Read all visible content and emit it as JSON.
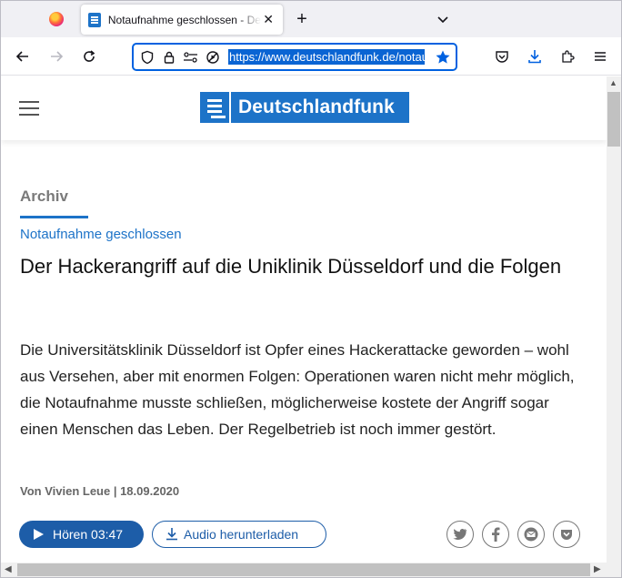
{
  "browser": {
    "tab_title": "Notaufnahme geschlossen - Deutschlandfunk",
    "tab_close": "✕",
    "new_tab": "+",
    "url": "https://www.deutschlandfunk.de/notaufnahme"
  },
  "site": {
    "logo_text": "Deutschlandfunk"
  },
  "article": {
    "section": "Archiv",
    "kicker": "Notaufnahme geschlossen",
    "headline": "Der Hackerangriff auf die Uniklinik Düsseldorf und die Folgen",
    "teaser": "Die Universitätsklinik Düsseldorf ist Opfer eines Hackerattacke geworden – wohl aus Versehen, aber mit enormen Folgen: Operationen waren nicht mehr möglich, die Notaufnahme musste schließen, möglicherweise kostete der Angriff sogar einen Menschen das Leben. Der Regelbetrieb ist noch immer gestört.",
    "byline": "Von Vivien Leue | 18.09.2020",
    "play_label": "Hören",
    "play_duration": "03:47",
    "download_label": "Audio herunterladen"
  },
  "share_icons": [
    "twitter-icon",
    "facebook-icon",
    "mail-icon",
    "pocket-icon"
  ],
  "colors": {
    "brand_blue": "#1d73c8",
    "button_blue": "#1d5da8",
    "url_focus": "#0061e0"
  }
}
